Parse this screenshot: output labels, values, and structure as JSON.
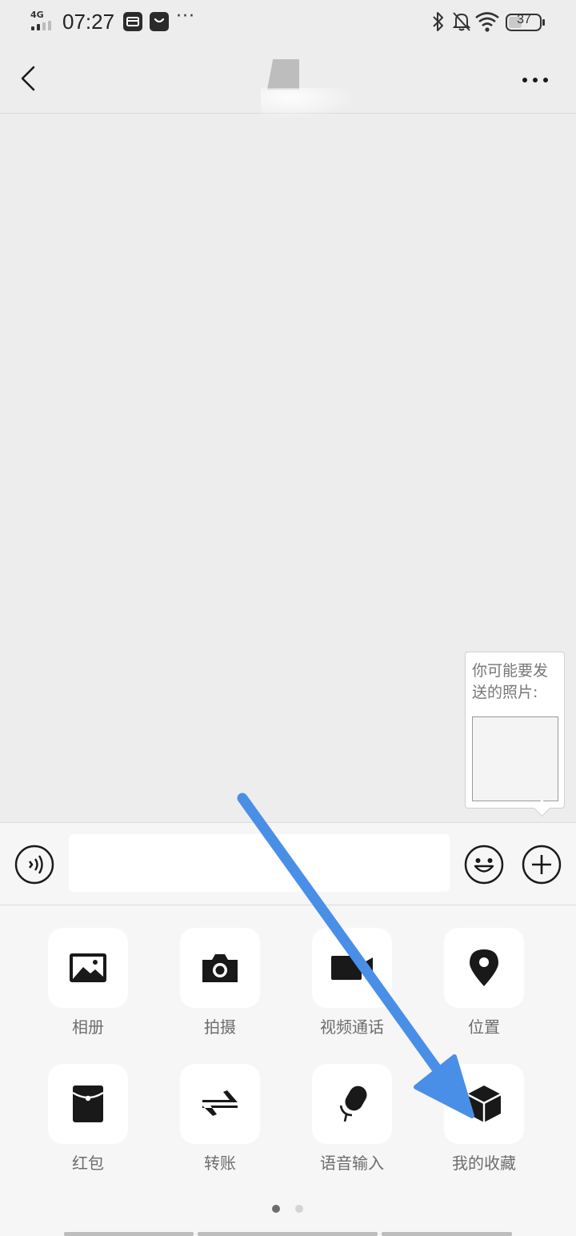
{
  "status_bar": {
    "network": "4G",
    "time": "07:27",
    "more": "···",
    "battery": "37",
    "icons": [
      "signal-icon",
      "wallet-icon",
      "shopping-bag-icon",
      "bluetooth-icon",
      "bell-off-icon",
      "wifi-icon",
      "battery-icon"
    ]
  },
  "nav": {
    "back_icon": "chevron-left-icon",
    "more_icon": "more-horizontal-icon"
  },
  "photo_tip": {
    "text": "你可能要发送的照片:"
  },
  "input_bar": {
    "text_value": "",
    "voice_icon": "voice-icon",
    "emoji_icon": "emoji-icon",
    "plus_icon": "plus-circle-icon"
  },
  "panel": {
    "items": [
      {
        "label": "相册",
        "icon": "photo-album-icon"
      },
      {
        "label": "拍摄",
        "icon": "camera-icon"
      },
      {
        "label": "视频通话",
        "icon": "video-call-icon"
      },
      {
        "label": "位置",
        "icon": "location-pin-icon"
      },
      {
        "label": "红包",
        "icon": "red-packet-icon"
      },
      {
        "label": "转账",
        "icon": "transfer-icon"
      },
      {
        "label": "语音输入",
        "icon": "microphone-icon"
      },
      {
        "label": "我的收藏",
        "icon": "favorites-cube-icon"
      }
    ],
    "page_count": 2,
    "current_page": 1
  },
  "annotation": {
    "icon": "pointer-arrow-icon",
    "color": "#4a8fe7"
  },
  "colors": {
    "chat_background": "#ededed",
    "panel_background": "#f6f6f6",
    "icon_dark": "#191919",
    "label_gray": "#6d6d6d"
  }
}
